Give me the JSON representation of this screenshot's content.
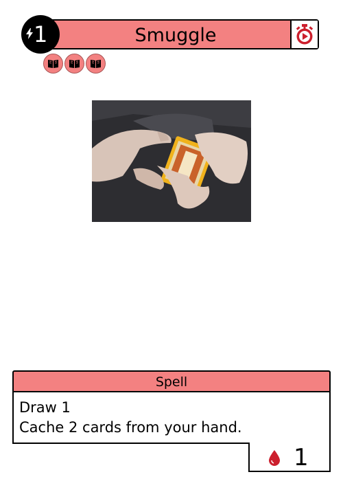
{
  "card": {
    "title": "Smuggle",
    "cost": "1",
    "cost_icon": "lightning-bolt-icon",
    "timing_icon": "stopwatch-play-icon",
    "tokens": [
      "book-icon",
      "book-icon",
      "book-icon"
    ],
    "art_description_icon": "hands-hiding-card-deck-art",
    "type": "Spell",
    "text": {
      "line1": "Draw 1",
      "line2": "Cache 2 cards from your hand."
    },
    "stat": {
      "icon": "blood-drop-icon",
      "value": "1"
    }
  },
  "colors": {
    "accent": "#f38181",
    "ink": "#000000",
    "icon_red": "#cc1f2d"
  }
}
